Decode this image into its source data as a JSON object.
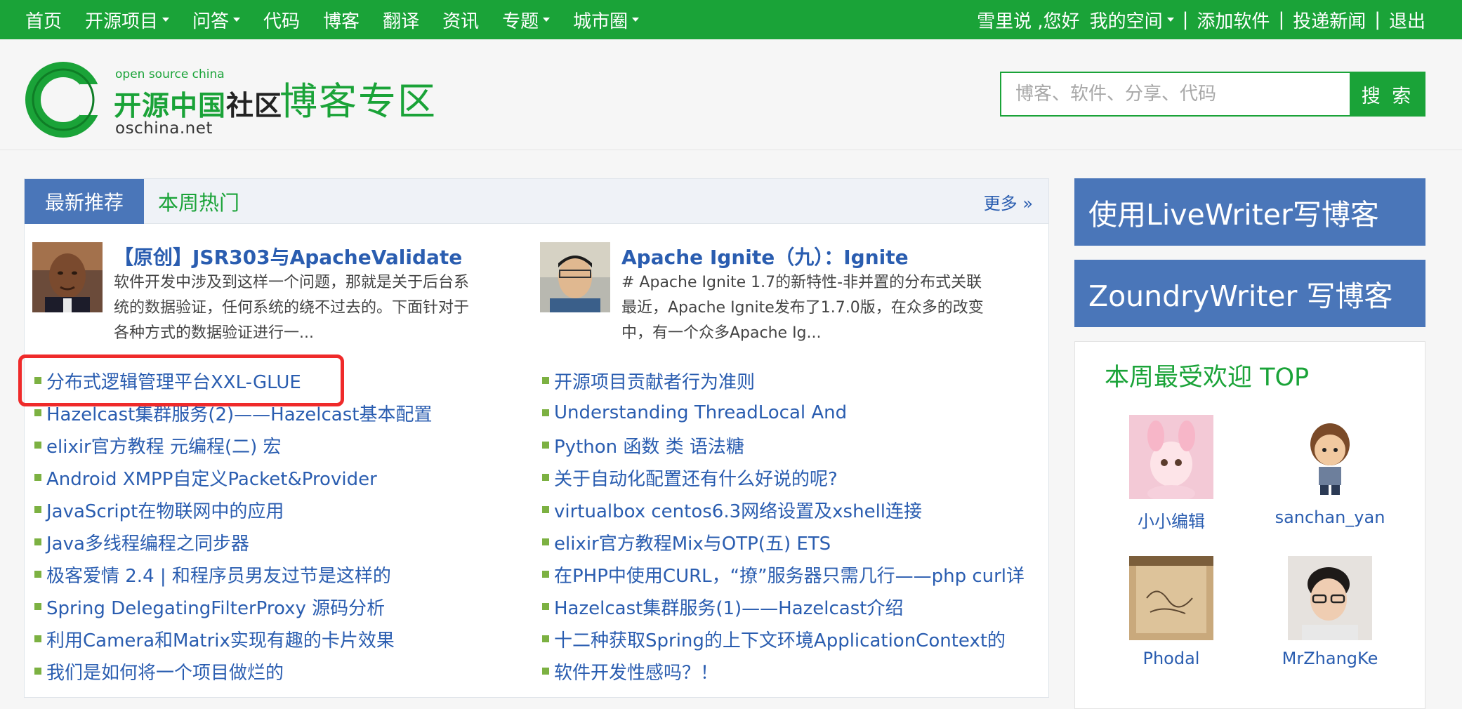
{
  "topnav": {
    "items": [
      {
        "label": "首页",
        "dropdown": false
      },
      {
        "label": "开源项目",
        "dropdown": true
      },
      {
        "label": "问答",
        "dropdown": true
      },
      {
        "label": "代码",
        "dropdown": false
      },
      {
        "label": "博客",
        "dropdown": false
      },
      {
        "label": "翻译",
        "dropdown": false
      },
      {
        "label": "资讯",
        "dropdown": false
      },
      {
        "label": "专题",
        "dropdown": true
      },
      {
        "label": "城市圈",
        "dropdown": true
      }
    ],
    "greeting": "雪里说 ,您好",
    "my_space": "我的空间",
    "add_software": "添加软件",
    "submit_news": "投递新闻",
    "logout": "退出",
    "separator": "|"
  },
  "header": {
    "logo_top": "open source china",
    "logo_main_green": "开源中国",
    "logo_main_dark": "社区",
    "logo_bottom": "oschina.net",
    "zone_title": "博客专区",
    "search_placeholder": "博客、软件、分享、代码",
    "search_button": "搜 索"
  },
  "panel": {
    "tab_active": "最新推荐",
    "tab_other": "本周热门",
    "more": "更多 »",
    "features": [
      {
        "title": "【原创】JSR303与ApacheValidate",
        "desc": "软件开发中涉及到这样一个问题，那就是关于后台系统的数据验证，任何系统的绕不过去的。下面针对于各种方式的数据验证进行一..."
      },
      {
        "title": "Apache Ignite（九）：Ignite",
        "desc": "# Apache Ignite 1.7的新特性-非并置的分布式关联 最近，Apache Ignite发布了1.7.0版，在众多的改变中，有一个众多Apache Ig..."
      }
    ],
    "left_list": [
      "分布式逻辑管理平台XXL-GLUE",
      "Hazelcast集群服务(2)——Hazelcast基本配置",
      "elixir官方教程 元编程(二) 宏",
      "Android XMPP自定义Packet&Provider",
      "JavaScript在物联网中的应用",
      "Java多线程编程之同步器",
      "极客爱情 2.4 | 和程序员男友过节是这样的",
      "Spring DelegatingFilterProxy 源码分析",
      "利用Camera和Matrix实现有趣的卡片效果",
      "我们是如何将一个项目做烂的"
    ],
    "right_list": [
      "开源项目贡献者行为准则",
      "Understanding ThreadLocal And",
      "Python 函数 类 语法糖",
      "关于自动化配置还有什么好说的呢?",
      "virtualbox centos6.3网络设置及xshell连接",
      "elixir官方教程Mix与OTP(五) ETS",
      "在PHP中使用CURL，“撩”服务器只需几行——php curl详",
      "Hazelcast集群服务(1)——Hazelcast介绍",
      "十二种获取Spring的上下文环境ApplicationContext的",
      "软件开发性感吗？！"
    ]
  },
  "sidebar": {
    "livewriter": "使用LiveWriter写博客",
    "zoundry": "ZoundryWriter 写博客",
    "top_title": "本周最受欢迎 TOP",
    "members": [
      "小小编辑",
      "sanchan_yan",
      "Phodal",
      "MrZhangKe"
    ]
  },
  "colors": {
    "brand_green": "#1aa338",
    "blue_accent": "#4a76b9",
    "link_blue": "#2a5db0",
    "highlight_red": "#ef2a2a"
  }
}
